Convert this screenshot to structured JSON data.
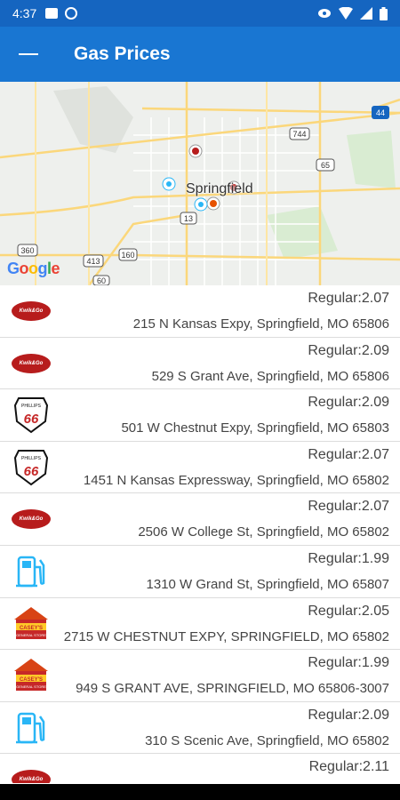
{
  "status_bar": {
    "time": "4:37"
  },
  "app_bar": {
    "title": "Gas Prices",
    "menu_icon": "menu-icon"
  },
  "map": {
    "city_label": "Springfield",
    "google_logo": "Google",
    "shields": [
      "744",
      "65",
      "13",
      "160",
      "413",
      "360",
      "60",
      "44"
    ]
  },
  "stations": [
    {
      "brand": "kwik-trip-logo",
      "price": "Regular:2.07",
      "address": "215 N Kansas Expy, Springfield, MO 65806"
    },
    {
      "brand": "kwik-trip-logo",
      "price": "Regular:2.09",
      "address": "529 S Grant Ave, Springfield, MO 65806"
    },
    {
      "brand": "phillips-66-logo",
      "price": "Regular:2.09",
      "address": "501 W Chestnut Expy, Springfield, MO 65803"
    },
    {
      "brand": "phillips-66-logo",
      "price": "Regular:2.07",
      "address": "1451 N Kansas Expressway, Springfield, MO 65802"
    },
    {
      "brand": "kwik-trip-logo",
      "price": "Regular:2.07",
      "address": "2506 W College St, Springfield, MO 65802"
    },
    {
      "brand": "gas-pump-icon",
      "price": "Regular:1.99",
      "address": "1310 W Grand St, Springfield, MO 65807"
    },
    {
      "brand": "caseys-logo",
      "price": "Regular:2.05",
      "address": "2715 W CHESTNUT EXPY, SPRINGFIELD, MO 65802"
    },
    {
      "brand": "caseys-logo",
      "price": "Regular:1.99",
      "address": "949 S GRANT AVE, SPRINGFIELD, MO 65806-3007"
    },
    {
      "brand": "gas-pump-icon",
      "price": "Regular:2.09",
      "address": "310 S Scenic Ave, Springfield, MO 65802"
    },
    {
      "brand": "kwik-trip-logo",
      "price": "Regular:2.11",
      "address": ""
    }
  ],
  "colors": {
    "status_bar": "#1565c0",
    "app_bar": "#1976d2",
    "kwik_red": "#b71c1c",
    "pump_blue": "#29b6f6"
  }
}
